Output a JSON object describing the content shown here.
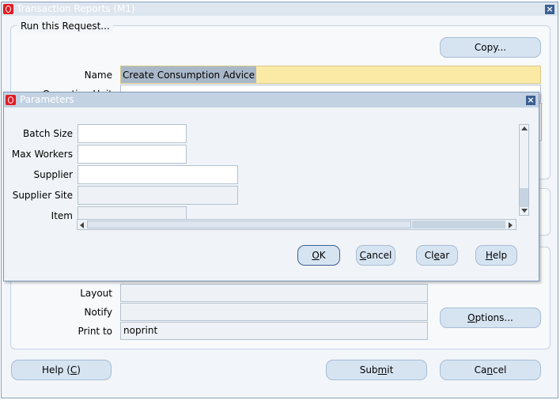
{
  "main_window": {
    "title": "Transaction Reports (M1)",
    "group_title": "Run this Request...",
    "copy_button": "Copy...",
    "name_label": "Name",
    "name_value": "Create Consumption Advice",
    "hidden_label_fragment": "Operating Unit",
    "layout_label": "Layout",
    "notify_label": "Notify",
    "print_to_label": "Print to",
    "print_to_value": "noprint",
    "options_button": "Options...",
    "help_button": "Help (C)",
    "submit_button": "Submit",
    "cancel_button": "Cancel"
  },
  "parameters_dialog": {
    "title": "Parameters",
    "fields": [
      {
        "label": "Batch Size",
        "value": ""
      },
      {
        "label": "Max Workers",
        "value": ""
      },
      {
        "label": "Supplier",
        "value": ""
      },
      {
        "label": "Supplier Site",
        "value": ""
      },
      {
        "label": "Item",
        "value": ""
      }
    ],
    "ok_button": "OK",
    "cancel_button": "Cancel",
    "clear_button": "Clear",
    "help_button": "Help"
  },
  "colors": {
    "title_text": "#ffffff",
    "highlight_field": "#fbeaa6",
    "selection": "#a9b8c9",
    "button_fill": "#d6e4f2"
  }
}
